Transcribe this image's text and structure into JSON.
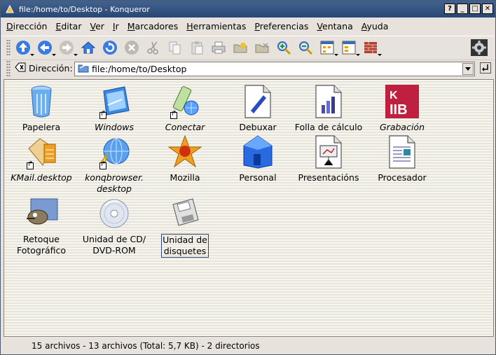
{
  "window": {
    "title": "file:/home/to/Desktop - Konqueror",
    "buttons": [
      "?",
      "_",
      "□",
      "✕"
    ]
  },
  "menu": [
    {
      "u": "D",
      "rest": "irección"
    },
    {
      "u": "E",
      "rest": "ditar"
    },
    {
      "u": "V",
      "rest": "er"
    },
    {
      "u": "I",
      "rest": "r"
    },
    {
      "u": "M",
      "rest": "arcadores"
    },
    {
      "u": "H",
      "rest": "erramientas"
    },
    {
      "u": "P",
      "rest": "referencias"
    },
    {
      "u": "V",
      "rest": "entana"
    },
    {
      "u": "A",
      "rest": "yuda"
    }
  ],
  "location": {
    "label": "Dirección:",
    "value": "file:/home/to/Desktop"
  },
  "icons": [
    {
      "label": "Papelera",
      "italic": false
    },
    {
      "label": "Windows",
      "italic": true
    },
    {
      "label": "Conectar",
      "italic": true
    },
    {
      "label": "Debuxar",
      "italic": false
    },
    {
      "label": "Folla de cálculo",
      "italic": false
    },
    {
      "label": "Grabación",
      "italic": true
    },
    {
      "label": "KMail.desktop",
      "italic": true
    },
    {
      "label": "konqbrowser.\ndesktop",
      "italic": true
    },
    {
      "label": "Mozilla",
      "italic": false
    },
    {
      "label": "Personal",
      "italic": false
    },
    {
      "label": "Presentacións",
      "italic": false
    },
    {
      "label": "Procesador",
      "italic": false
    },
    {
      "label": "Retoque\nFotográfico",
      "italic": false
    },
    {
      "label": "Unidad de CD/\nDVD-ROM",
      "italic": false
    },
    {
      "label": "Unidad de\ndisquetes",
      "italic": false,
      "selected": true
    }
  ],
  "status": "15 archivos - 13 archivos (Total: 5,7 KB) - 2 directorios",
  "colors": {
    "titlebar": "#2a4775",
    "chrome": "#e7e3dc",
    "selection": "#2a4775"
  }
}
